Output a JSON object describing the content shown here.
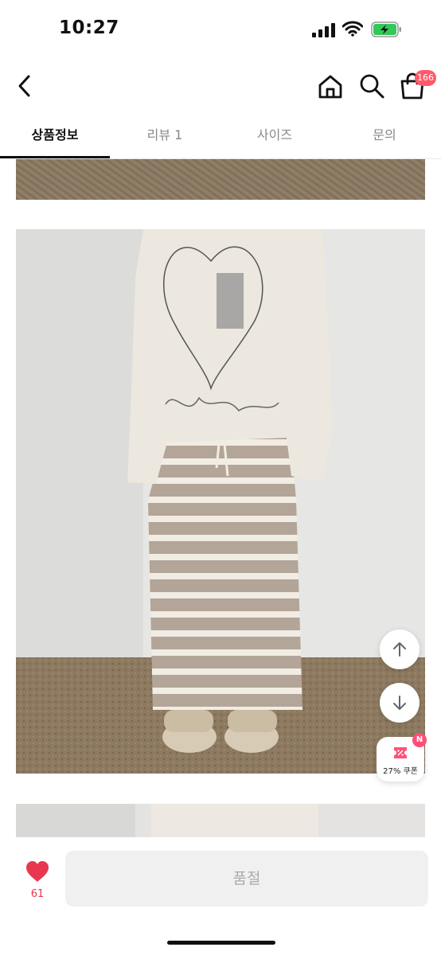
{
  "status_bar": {
    "time": "10:27"
  },
  "header": {
    "cart_count": "166"
  },
  "tabs": [
    {
      "label": "상품정보",
      "active": true
    },
    {
      "label": "리뷰 1",
      "active": false
    },
    {
      "label": "사이즈",
      "active": false
    },
    {
      "label": "문의",
      "active": false
    }
  ],
  "coupon": {
    "label": "27% 쿠폰",
    "badge": "N"
  },
  "bottom": {
    "like_count": "61",
    "main_button": "품절"
  },
  "colors": {
    "accent": "#ff5a6a",
    "heart": "#e8384f",
    "coupon_pink": "#ff4f79"
  },
  "icons": [
    "back-icon",
    "home-icon",
    "search-icon",
    "cart-icon",
    "arrow-up-icon",
    "arrow-down-icon",
    "coupon-icon",
    "heart-icon"
  ]
}
